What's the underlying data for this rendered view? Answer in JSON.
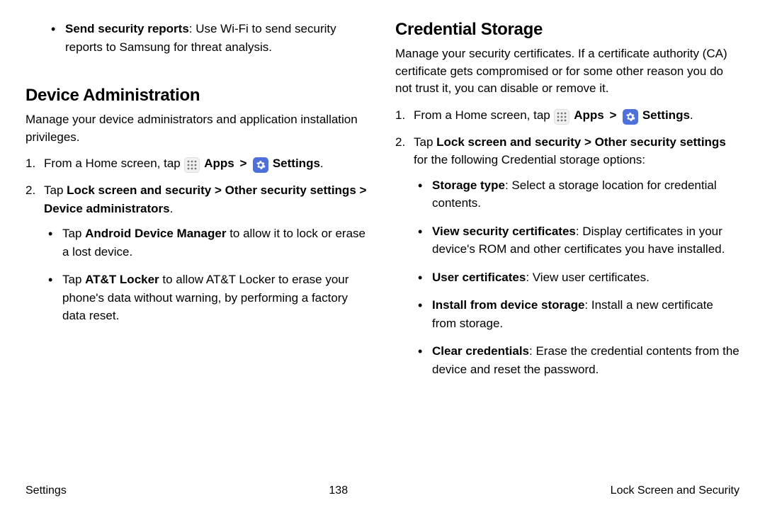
{
  "left": {
    "topBullet": {
      "bold": "Send security reports",
      "rest": ": Use Wi-Fi to send security reports to Samsung for threat analysis."
    },
    "heading": "Device Administration",
    "intro": "Manage your device administrators and application installation privileges.",
    "step1_pre": "From a Home screen, tap ",
    "apps_label": "Apps",
    "settings_label": "Settings",
    "step1_post": ".",
    "step2_a": "Tap ",
    "step2_bold": "Lock screen and security > Other security settings > Device administrators",
    "step2_b": ".",
    "sub1_a": "Tap ",
    "sub1_bold": "Android Device Manager",
    "sub1_b": " to allow it to lock or erase a lost device.",
    "sub2_a": "Tap ",
    "sub2_bold": "AT&T Locker",
    "sub2_b": " to allow AT&T Locker to erase your phone's data without warning, by performing a factory data reset."
  },
  "right": {
    "heading": "Credential Storage",
    "intro": "Manage your security certificates. If a certificate authority (CA) certificate gets compromised or for some other reason you do not trust it, you can disable or remove it.",
    "step1_pre": "From a Home screen, tap ",
    "apps_label": "Apps",
    "settings_label": "Settings",
    "step1_post": ".",
    "step2_a": "Tap ",
    "step2_bold": "Lock screen and security > Other security settings",
    "step2_b": " for the following Credential storage options:",
    "b1_bold": "Storage type",
    "b1_rest": ": Select a storage location for credential contents.",
    "b2_bold": "View security certificates",
    "b2_rest": ": Display certificates in your device's ROM and other certificates you have installed.",
    "b3_bold": "User certificates",
    "b3_rest": ": View user certificates.",
    "b4_bold": "Install from device storage",
    "b4_rest": ": Install a new certificate from storage.",
    "b5_bold": "Clear credentials",
    "b5_rest": ": Erase the credential contents from the device and reset the password."
  },
  "footer": {
    "left": "Settings",
    "center": "138",
    "right": "Lock Screen and Security"
  }
}
